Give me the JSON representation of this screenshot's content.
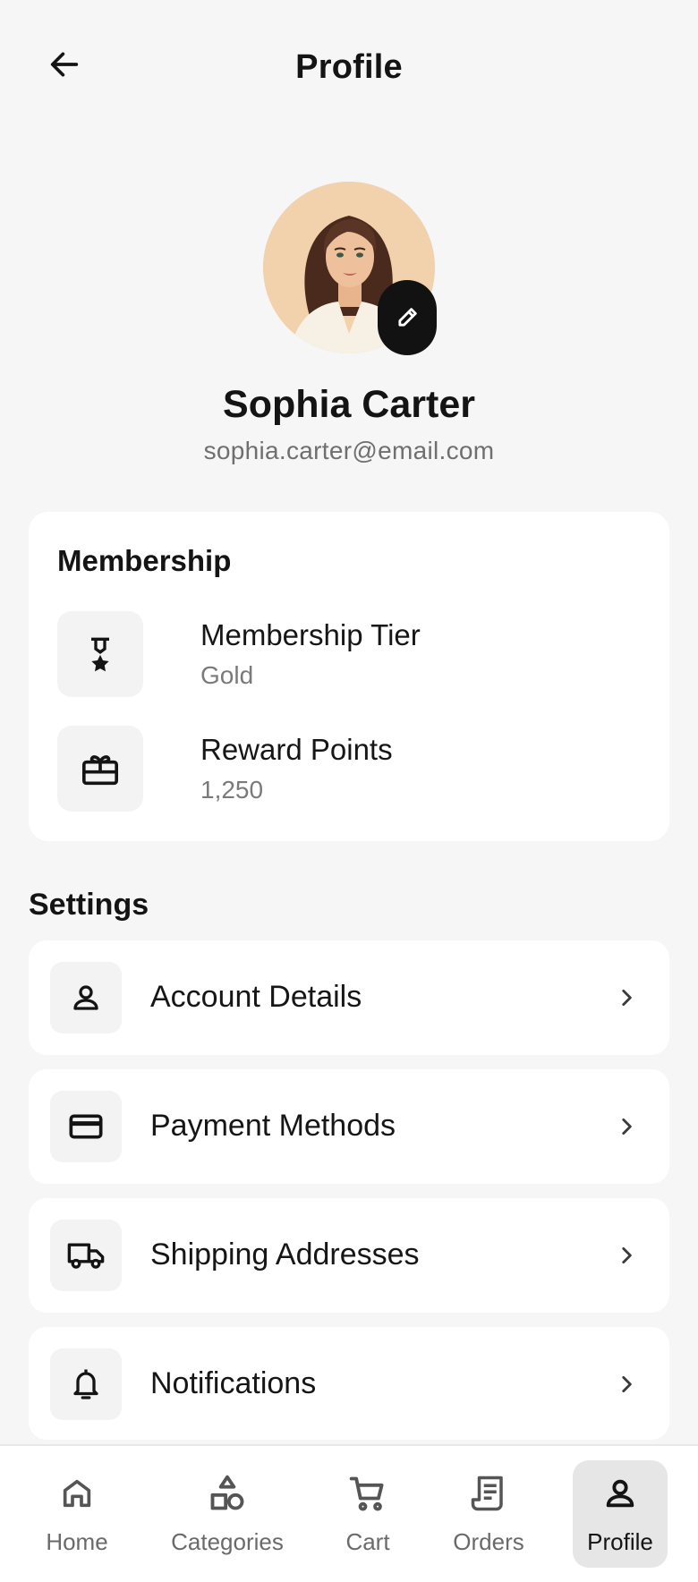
{
  "header": {
    "title": "Profile",
    "back_icon": "arrow-left-icon"
  },
  "profile": {
    "name": "Sophia Carter",
    "email": "sophia.carter@email.com",
    "edit_icon": "pencil-icon"
  },
  "membership": {
    "title": "Membership",
    "items": [
      {
        "label": "Membership Tier",
        "value": "Gold",
        "icon": "medal-icon"
      },
      {
        "label": "Reward Points",
        "value": "1,250",
        "icon": "gift-card-icon"
      }
    ]
  },
  "settings": {
    "title": "Settings",
    "items": [
      {
        "label": "Account Details",
        "icon": "person-icon"
      },
      {
        "label": "Payment Methods",
        "icon": "credit-card-icon"
      },
      {
        "label": "Shipping Addresses",
        "icon": "truck-icon"
      },
      {
        "label": "Notifications",
        "icon": "bell-icon"
      }
    ]
  },
  "nav": {
    "items": [
      {
        "label": "Home",
        "icon": "home-icon",
        "active": false
      },
      {
        "label": "Categories",
        "icon": "categories-icon",
        "active": false
      },
      {
        "label": "Cart",
        "icon": "cart-icon",
        "active": false
      },
      {
        "label": "Orders",
        "icon": "receipt-icon",
        "active": false
      },
      {
        "label": "Profile",
        "icon": "person-icon",
        "active": true
      }
    ]
  },
  "colors": {
    "background": "#f6f6f6",
    "card": "#ffffff",
    "accent_dark": "#121212",
    "muted_text": "#6f6f6f",
    "active_nav_bg": "#e6e6e6"
  }
}
